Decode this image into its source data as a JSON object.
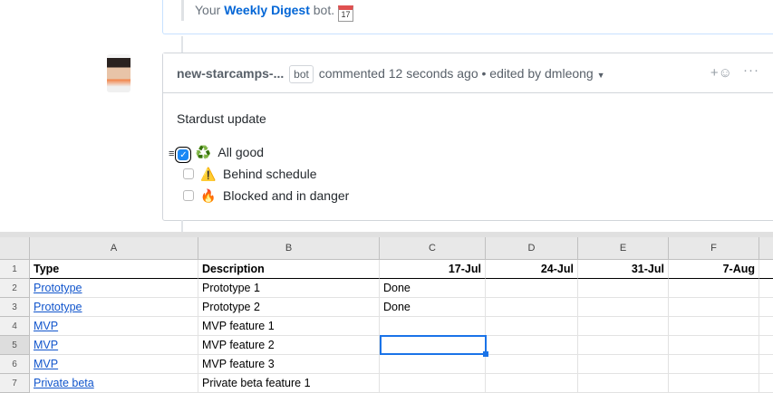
{
  "github": {
    "prev_comment": {
      "prefix": "Your",
      "link": "Weekly Digest",
      "suffix": "bot.",
      "calendar_icon_text": "17"
    },
    "comment": {
      "author": "new-starcamps-...",
      "badge": "bot",
      "meta": "commented 12 seconds ago • edited by dmleong",
      "title": "Stardust update",
      "tasks": [
        {
          "label": "All good",
          "checked": true,
          "emoji": "♻️"
        },
        {
          "label": "Behind schedule",
          "checked": false,
          "emoji": "⚠️"
        },
        {
          "label": "Blocked and in danger",
          "checked": false,
          "emoji": "🔥"
        }
      ]
    }
  },
  "sheet": {
    "columns": [
      "A",
      "B",
      "C",
      "D",
      "E",
      "F"
    ],
    "rows": [
      {
        "num": "1",
        "cells": [
          "Type",
          "Description",
          "17-Jul",
          "24-Jul",
          "31-Jul",
          "7-Aug"
        ]
      },
      {
        "num": "2",
        "cells": [
          "Prototype",
          "Prototype 1",
          "Done",
          "",
          "",
          ""
        ]
      },
      {
        "num": "3",
        "cells": [
          "Prototype",
          "Prototype 2",
          "Done",
          "",
          "",
          ""
        ]
      },
      {
        "num": "4",
        "cells": [
          "MVP",
          "MVP feature 1",
          "",
          "",
          "",
          ""
        ]
      },
      {
        "num": "5",
        "cells": [
          "MVP",
          "MVP feature 2",
          "",
          "",
          "",
          ""
        ]
      },
      {
        "num": "6",
        "cells": [
          "MVP",
          "MVP feature 3",
          "",
          "",
          "",
          ""
        ]
      },
      {
        "num": "7",
        "cells": [
          "Private beta",
          "Private beta feature 1",
          "",
          "",
          "",
          ""
        ]
      }
    ],
    "selected_cell": "C5"
  }
}
